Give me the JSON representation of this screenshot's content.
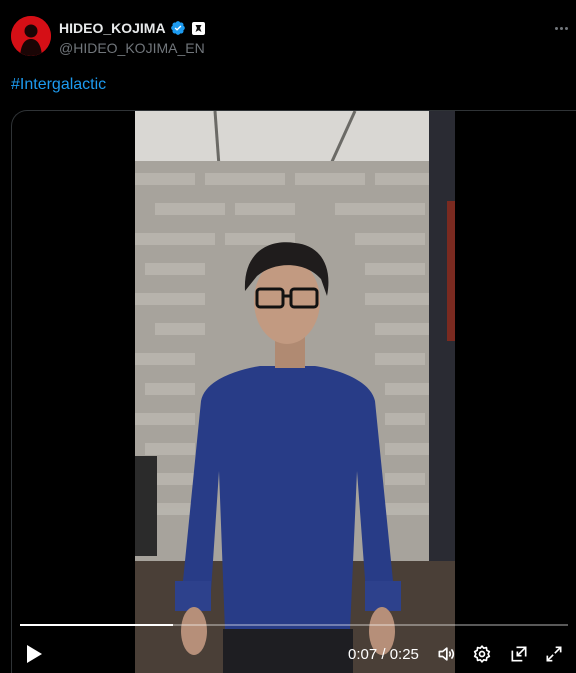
{
  "author": {
    "display_name": "HIDEO_KOJIMA",
    "handle": "@HIDEO_KOJIMA_EN",
    "avatar_color": "#d50f16",
    "verified_icon": "verified-badge-icon",
    "affiliation_icon": "affiliate-badge-icon"
  },
  "more_icon": "more-options-icon",
  "tweet": {
    "text": "#Intergalactic",
    "link_color": "#1d9bf0"
  },
  "video": {
    "progress": 0.28,
    "current_time": "0:07",
    "duration": "0:25",
    "time_display": "0:07 / 0:25",
    "controls": [
      "play-icon",
      "volume-icon",
      "settings-icon",
      "pop-out-icon",
      "fullscreen-icon"
    ]
  }
}
